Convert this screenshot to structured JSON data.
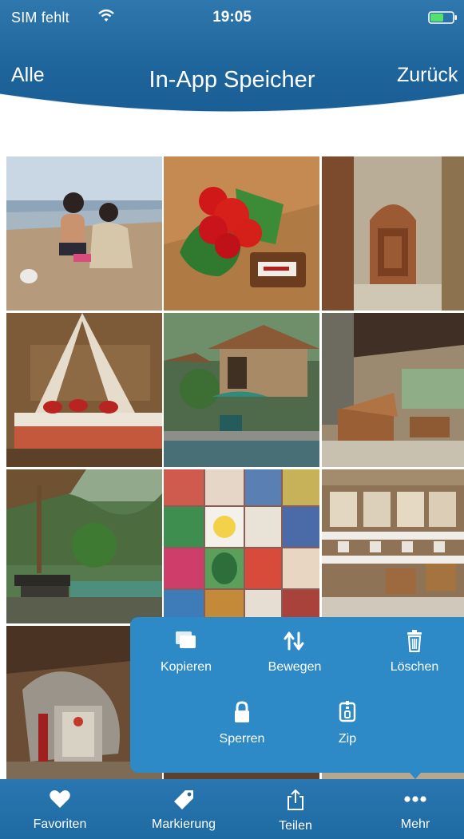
{
  "status_bar": {
    "carrier": "SIM fehlt",
    "time": "19:05"
  },
  "nav": {
    "left_label": "Alle",
    "title": "In-App Speicher",
    "right_label": "Zurück"
  },
  "action_menu": {
    "copy": "Kopieren",
    "move": "Bewegen",
    "delete": "Löschen",
    "lock": "Sperren",
    "zip": "Zip"
  },
  "tab_bar": {
    "favorites": "Favoriten",
    "tag": "Markierung",
    "share": "Teilen",
    "more": "Mehr"
  },
  "colors": {
    "header": "#1f669d",
    "popover": "#2d8ac7",
    "tabbar": "#1e6aa3"
  }
}
